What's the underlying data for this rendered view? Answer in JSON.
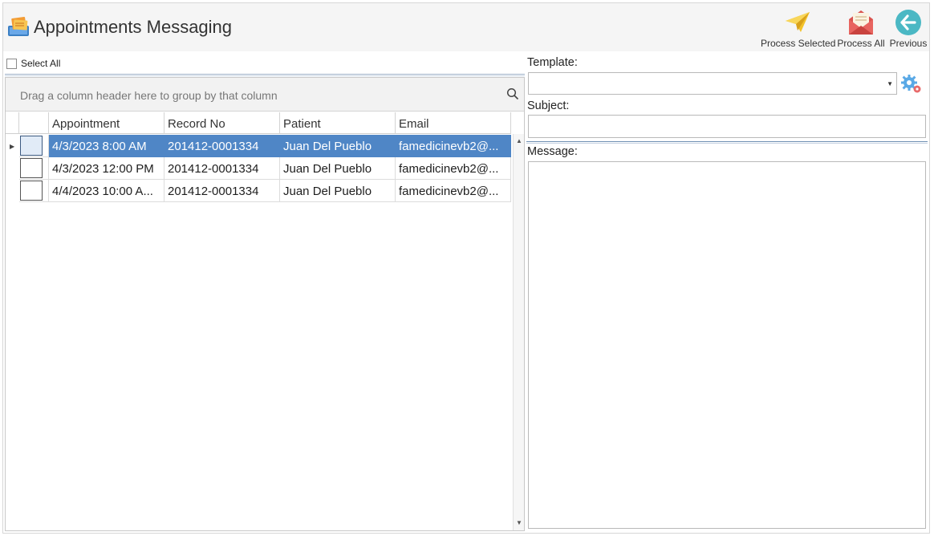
{
  "app": {
    "title": "Appointments Messaging",
    "icon": "appointments-app-icon"
  },
  "toolbar": {
    "process_selected_label": "Process Selected",
    "process_all_label": "Process All",
    "previous_label": "Previous"
  },
  "select_all": {
    "label": "Select All",
    "checked": false
  },
  "grid": {
    "group_panel_text": "Drag a column header here to group by that column",
    "columns": [
      "Appointment",
      "Record No",
      "Patient",
      "Email"
    ],
    "rows": [
      {
        "appointment": "4/3/2023 8:00 AM",
        "record_no": "201412-0001334",
        "patient": "Juan Del Pueblo",
        "email": "famedicinevb2@...",
        "selected": true,
        "checked": false
      },
      {
        "appointment": "4/3/2023 12:00 PM",
        "record_no": "201412-0001334",
        "patient": "Juan Del Pueblo",
        "email": "famedicinevb2@...",
        "selected": false,
        "checked": false
      },
      {
        "appointment": "4/4/2023 10:00 A...",
        "record_no": "201412-0001334",
        "patient": "Juan Del Pueblo",
        "email": "famedicinevb2@...",
        "selected": false,
        "checked": false
      }
    ]
  },
  "form": {
    "template_label": "Template:",
    "template_value": "",
    "subject_label": "Subject:",
    "subject_value": "",
    "message_label": "Message:",
    "message_value": ""
  },
  "colors": {
    "selection": "#4f86c6",
    "header_bg": "#f5f5f5"
  }
}
